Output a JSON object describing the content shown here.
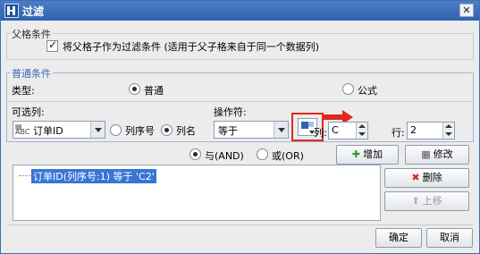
{
  "window": {
    "title": "过滤",
    "close_glyph": "✕"
  },
  "parent_condition": {
    "group_label": "父格条件",
    "checkbox_checked": true,
    "checkbox_label": "将父格子作为过滤条件 (适用于父子格来自于同一个数据列)"
  },
  "common_condition": {
    "group_label": "普通条件",
    "type_label": "类型:",
    "type_options": [
      {
        "label": "普通",
        "selected": true
      },
      {
        "label": "公式",
        "selected": false
      }
    ],
    "column_label": "可选列:",
    "column_value": "订单ID",
    "column_mode_options": [
      {
        "label": "列序号",
        "selected": false
      },
      {
        "label": "列名",
        "selected": true
      }
    ],
    "operator_label": "操作符:",
    "operator_value": "等于",
    "col_label": "列:",
    "col_value": "C",
    "row_label": "行:",
    "row_value": "2"
  },
  "logic": {
    "options": [
      {
        "label": "与(AND)",
        "selected": true
      },
      {
        "label": "或(OR)",
        "selected": false
      }
    ]
  },
  "buttons": {
    "add": "增加",
    "modify": "修改",
    "delete": "删除",
    "move_up": "上移",
    "ok": "确定",
    "cancel": "取消"
  },
  "condition_list": {
    "items": [
      "订单ID(列序号:1) 等于 'C2'"
    ]
  },
  "colors": {
    "titlebar": "#2f62b0",
    "highlight": "#e0281e",
    "selection": "#3875d7"
  }
}
